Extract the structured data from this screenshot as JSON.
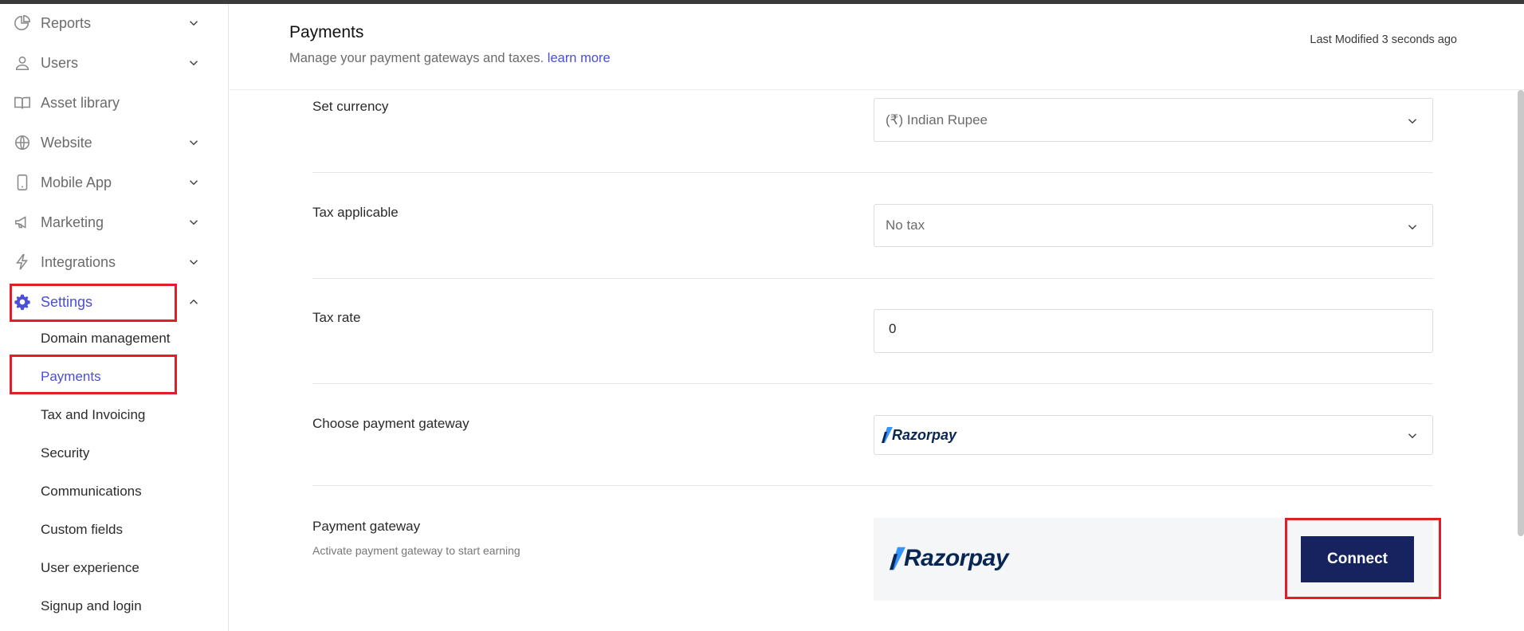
{
  "sidebar": {
    "items": [
      {
        "label": "Reports",
        "icon": "pie-chart-icon"
      },
      {
        "label": "Users",
        "icon": "user-icon"
      },
      {
        "label": "Asset library",
        "icon": "book-icon"
      },
      {
        "label": "Website",
        "icon": "globe-icon"
      },
      {
        "label": "Mobile App",
        "icon": "mobile-icon"
      },
      {
        "label": "Marketing",
        "icon": "megaphone-icon"
      },
      {
        "label": "Integrations",
        "icon": "lightning-icon"
      },
      {
        "label": "Settings",
        "icon": "gear-icon"
      }
    ],
    "settings_sub": [
      "Domain management",
      "Payments",
      "Tax and Invoicing",
      "Security",
      "Communications",
      "Custom fields",
      "User experience",
      "Signup and login"
    ]
  },
  "header": {
    "title": "Payments",
    "subtitle": "Manage your payment gateways and taxes.",
    "learn_more": "learn more",
    "last_modified": "Last Modified 3 seconds ago"
  },
  "form": {
    "currency": {
      "label": "Set currency",
      "value": "(₹) Indian Rupee"
    },
    "tax_applicable": {
      "label": "Tax applicable",
      "value": "No tax"
    },
    "tax_rate": {
      "label": "Tax rate",
      "value": "0"
    },
    "gateway_choice": {
      "label": "Choose payment gateway",
      "value": "Razorpay"
    },
    "gateway": {
      "label": "Payment gateway",
      "hint": "Activate payment gateway to start earning",
      "brand": "Razorpay",
      "connect_label": "Connect"
    }
  },
  "colors": {
    "accent": "#4a4ed8",
    "connect_bg": "#16235e",
    "highlight": "#e11d2a",
    "razorpay_blue": "#3395ff",
    "razorpay_navy": "#072654"
  }
}
